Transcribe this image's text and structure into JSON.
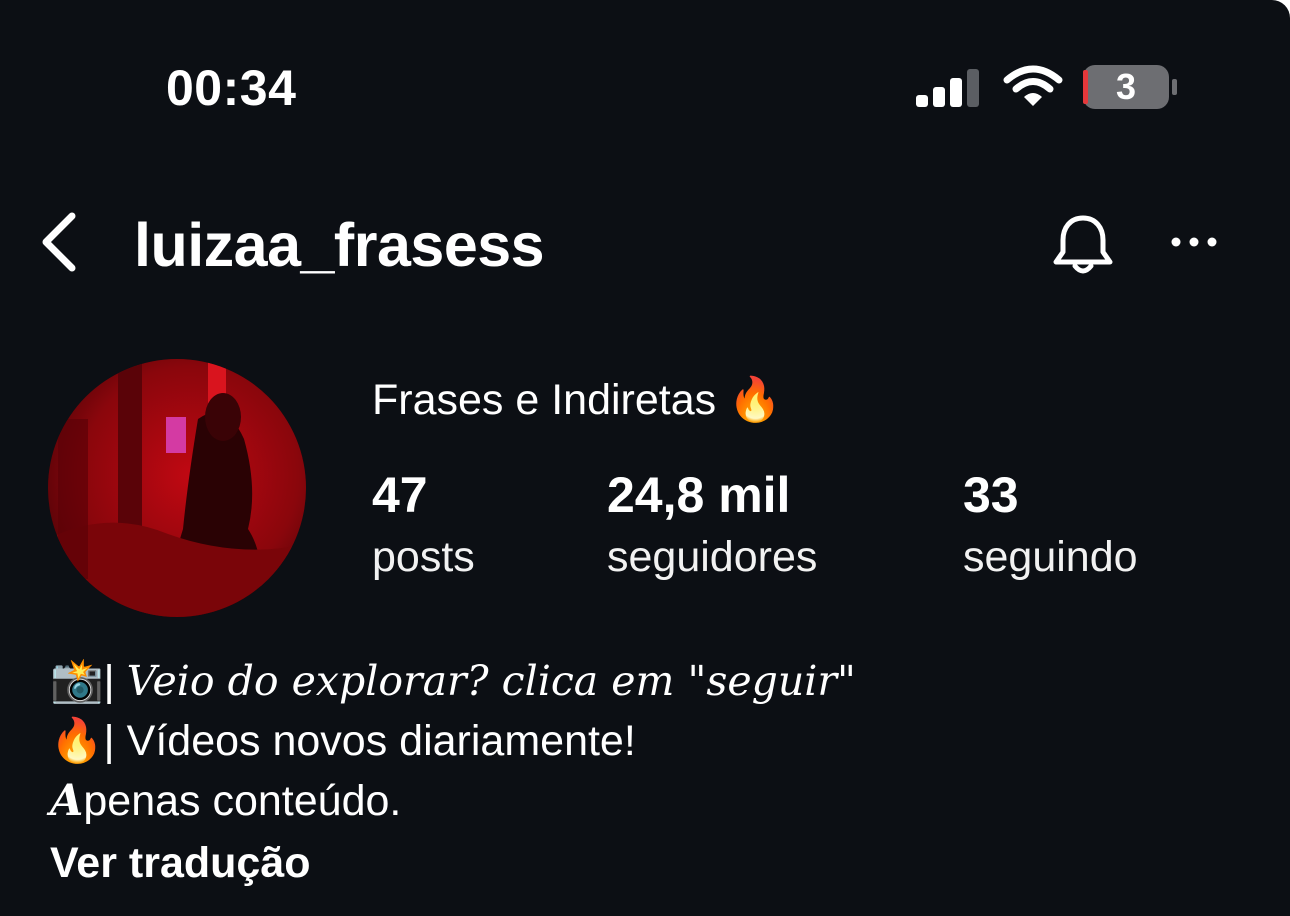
{
  "status_bar": {
    "time": "00:34",
    "battery_level": "3",
    "icons": [
      "cellular-signal-icon",
      "wifi-icon",
      "battery-icon"
    ]
  },
  "nav": {
    "username": "luizaa_frasess",
    "icons": [
      "back-chevron-icon",
      "bell-icon",
      "more-options-icon"
    ]
  },
  "profile": {
    "display_name": "Frases e Indiretas 🔥",
    "stats": [
      {
        "value": "47",
        "label": "posts"
      },
      {
        "value": "24,8 mil",
        "label": "seguidores"
      },
      {
        "value": "33",
        "label": "seguindo"
      }
    ]
  },
  "bio": {
    "line1_prefix": "📸| ",
    "line1_text": "Veio do explorar? clica em \"seguir\"",
    "line2": "🔥| Vídeos novos diariamente!",
    "line3_cap": "A",
    "line3_rest": "penas conteúdo.",
    "translate_label": "Ver tradução"
  },
  "colors": {
    "background": "#0c0f14",
    "text": "#ffffff",
    "avatar_tint": "#c00812",
    "battery_low": "#e5383b"
  }
}
